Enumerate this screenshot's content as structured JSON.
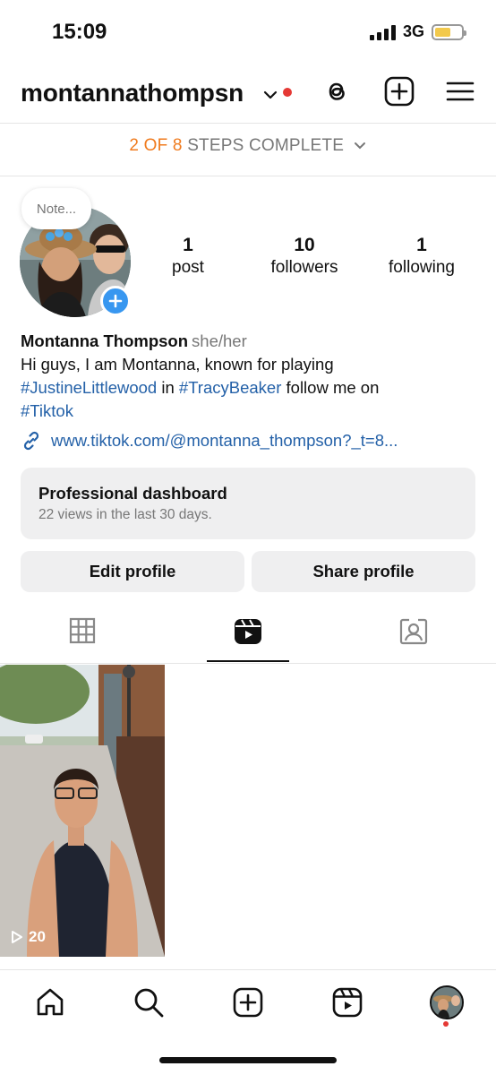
{
  "status_bar": {
    "time": "15:09",
    "network": "3G"
  },
  "header": {
    "username": "montannathompsn"
  },
  "steps": {
    "progress": "2 OF 8",
    "label": "STEPS COMPLETE"
  },
  "profile": {
    "note": "Note...",
    "stats": [
      {
        "value": "1",
        "label": "post"
      },
      {
        "value": "10",
        "label": "followers"
      },
      {
        "value": "1",
        "label": "following"
      }
    ],
    "name": "Montanna Thompson",
    "pronouns": "she/her",
    "bio_line1": "Hi guys, I am Montanna, known for playing",
    "bio_tag1": "#JustineLittlewood",
    "bio_in": " in ",
    "bio_tag2": "#TracyBeaker",
    "bio_follow": " follow me on",
    "bio_tag3": "#Tiktok",
    "link": "www.tiktok.com/@montanna_thompson?_t=8..."
  },
  "dashboard": {
    "title": "Professional dashboard",
    "subtitle": "22 views in the last 30 days."
  },
  "buttons": {
    "edit": "Edit profile",
    "share": "Share profile"
  },
  "reels": [
    {
      "views": "20"
    }
  ],
  "colors": {
    "accent": "#3897f0",
    "link": "#2461a8",
    "steps_orange": "#f07b1e",
    "notification": "#e53935"
  },
  "icons": {
    "header": [
      "chevron-down-icon",
      "threads-icon",
      "create-post-icon",
      "menu-icon"
    ],
    "tabs": [
      "grid-icon",
      "reels-icon",
      "tagged-icon"
    ],
    "bottom_nav": [
      "home-icon",
      "search-icon",
      "create-icon",
      "reels-icon",
      "profile-avatar"
    ]
  }
}
